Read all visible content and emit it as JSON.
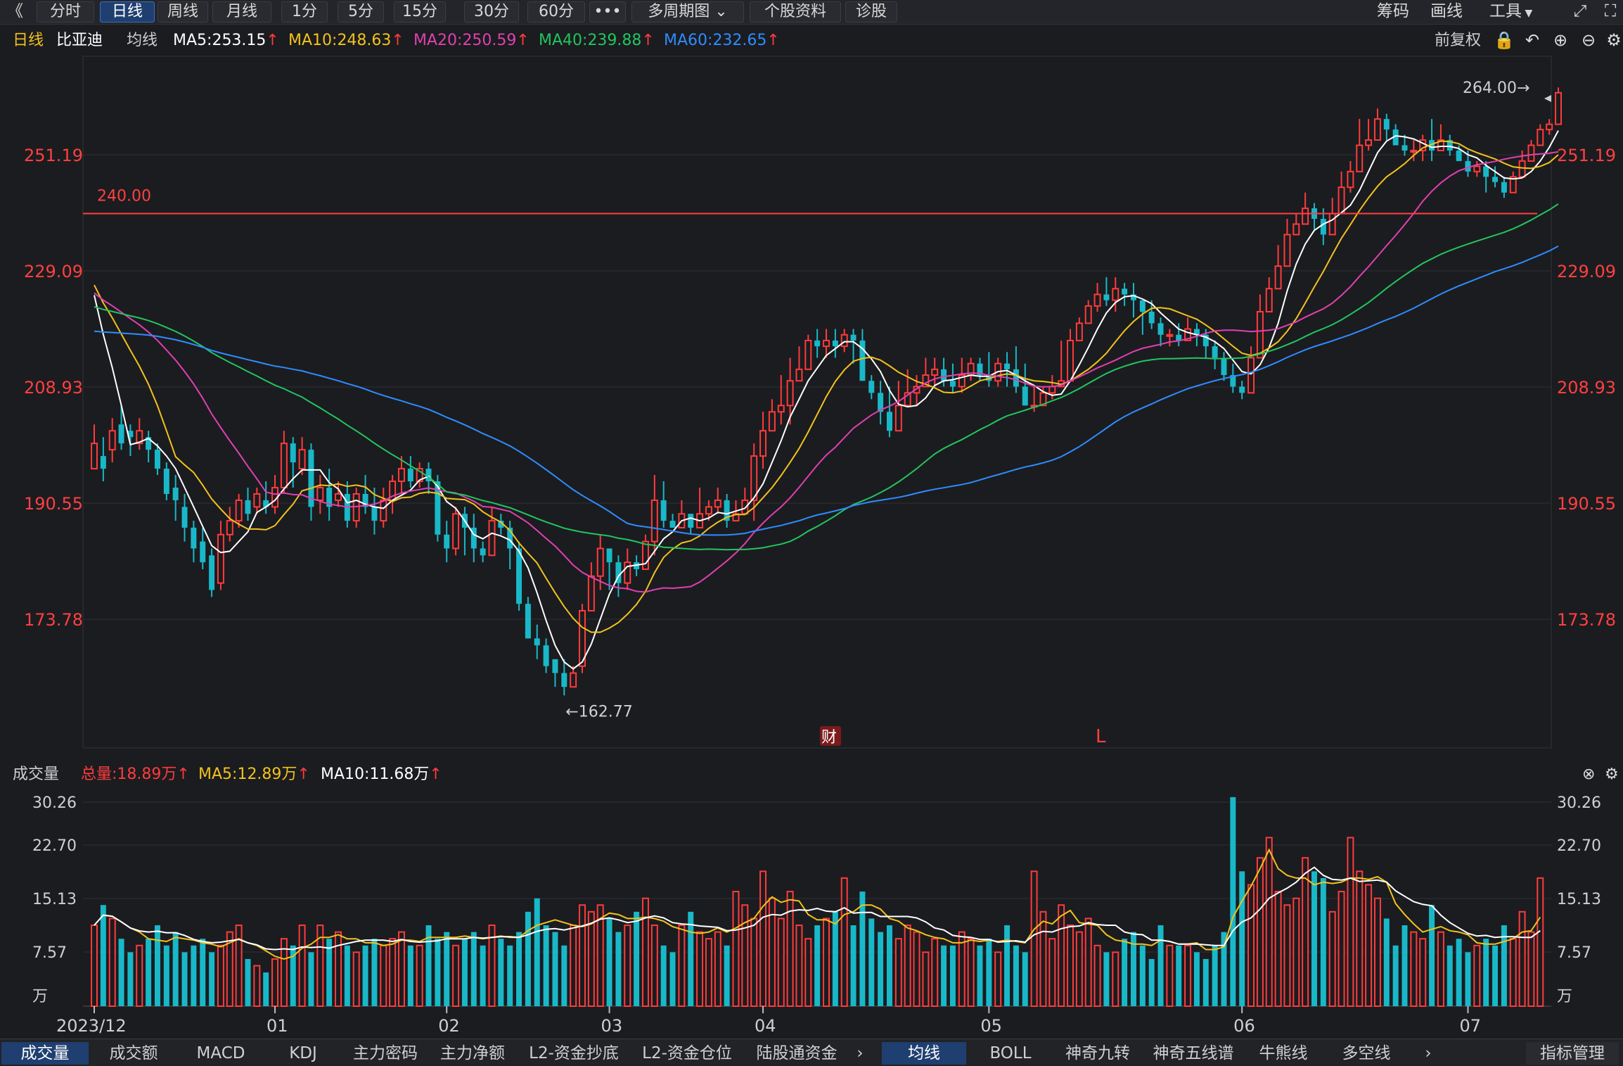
{
  "toolbar": {
    "back": "《",
    "tabs": [
      "分时",
      "日线",
      "周线",
      "月线",
      "1分",
      "5分",
      "15分",
      "30分",
      "60分",
      "•••",
      "多周期图",
      "个股资料",
      "诊股"
    ],
    "active_tab": "日线",
    "right": [
      "筹码",
      "画线",
      "工具"
    ]
  },
  "ma_header": {
    "period": "日线",
    "stock": "比亚迪",
    "label": "均线",
    "items": [
      {
        "text": "MA5:253.15",
        "color": "#ffffff"
      },
      {
        "text": "MA10:248.63",
        "color": "#f2c21b"
      },
      {
        "text": "MA20:250.59",
        "color": "#e040b0"
      },
      {
        "text": "MA40:239.88",
        "color": "#22c55e"
      },
      {
        "text": "MA60:232.65",
        "color": "#2f8cff"
      }
    ],
    "adjust": "前复权"
  },
  "price_panel": {
    "y_ticks": [
      "251.19",
      "229.09",
      "208.93",
      "190.55",
      "173.78"
    ],
    "hline_label": "240.00",
    "high_label": "264.00→",
    "low_label": "←162.77",
    "marker_cai": "财",
    "marker_l": "L"
  },
  "volume_header": {
    "title": "成交量",
    "total": "总量:18.89万",
    "ma5": "MA5:12.89万",
    "ma10": "MA10:11.68万"
  },
  "volume_panel": {
    "y_ticks": [
      "30.26",
      "22.70",
      "15.13",
      "7.57",
      "万"
    ]
  },
  "x_labels": [
    "2023/12",
    "01",
    "02",
    "03",
    "04",
    "05",
    "06",
    "07"
  ],
  "bottom_tabs_left": [
    "成交量",
    "成交额",
    "MACD",
    "KDJ",
    "主力密码",
    "主力净额",
    "L2-资金抄底",
    "L2-资金仓位",
    "陆股通资金"
  ],
  "bottom_tabs_right": [
    "均线",
    "BOLL",
    "神奇九转",
    "神奇五线谱",
    "牛熊线",
    "多空线"
  ],
  "bottom_right_button": "指标管理",
  "colors": {
    "up": "#ff3b3b",
    "down": "#19b8c8",
    "bg": "#1b1c20",
    "grid": "#2e3036"
  },
  "chart_data": {
    "type": "candlestick",
    "ylim": [
      162,
      264
    ],
    "hline": 240.0,
    "high": 264.0,
    "low": 162.77,
    "x": [
      "2023-12",
      "01",
      "02",
      "03",
      "04",
      "05",
      "06",
      "07"
    ],
    "ohlc": [
      [
        196,
        200,
        198,
        203
      ],
      [
        198,
        196,
        194,
        201
      ],
      [
        199,
        202,
        197,
        204
      ],
      [
        203,
        200,
        199,
        206
      ],
      [
        202,
        201,
        198,
        203
      ],
      [
        200,
        202,
        199,
        204
      ],
      [
        201,
        199,
        197,
        202
      ],
      [
        199,
        196,
        195,
        200
      ],
      [
        196,
        192,
        191,
        197
      ],
      [
        193,
        191,
        188,
        195
      ],
      [
        190,
        187,
        185,
        192
      ],
      [
        187,
        184,
        182,
        188
      ],
      [
        185,
        182,
        181,
        187
      ],
      [
        183,
        178,
        177,
        184
      ],
      [
        179,
        186,
        178,
        188
      ],
      [
        186,
        188,
        185,
        190
      ],
      [
        188,
        191,
        187,
        192
      ],
      [
        191,
        189,
        188,
        193
      ],
      [
        190,
        192,
        189,
        193
      ],
      [
        191,
        190,
        189,
        194
      ],
      [
        190,
        193,
        189,
        195
      ],
      [
        193,
        200,
        192,
        202
      ],
      [
        200,
        197,
        193,
        201
      ],
      [
        196,
        199,
        195,
        201
      ],
      [
        199,
        190,
        188,
        200
      ],
      [
        191,
        193,
        189,
        195
      ],
      [
        193,
        190,
        188,
        196
      ],
      [
        191,
        192,
        190,
        194
      ],
      [
        192,
        188,
        187,
        194
      ],
      [
        188,
        192,
        187,
        193
      ],
      [
        192,
        190,
        189,
        195
      ],
      [
        190,
        188,
        186,
        193
      ],
      [
        188,
        191,
        187,
        193
      ],
      [
        191,
        194,
        189,
        195
      ],
      [
        194,
        196,
        192,
        198
      ],
      [
        196,
        194,
        193,
        198
      ],
      [
        194,
        196,
        193,
        197
      ],
      [
        196,
        194,
        192,
        197
      ],
      [
        194,
        186,
        185,
        195
      ],
      [
        186,
        184,
        182,
        188
      ],
      [
        184,
        189,
        183,
        190
      ],
      [
        189,
        187,
        183,
        190
      ],
      [
        187,
        184,
        182,
        189
      ],
      [
        184,
        183,
        182,
        185
      ],
      [
        183,
        188,
        183,
        190
      ],
      [
        188,
        187,
        186,
        189
      ],
      [
        187,
        184,
        181,
        188
      ],
      [
        184,
        176,
        175,
        185
      ],
      [
        176,
        171,
        171,
        177
      ],
      [
        171,
        170,
        168,
        173
      ],
      [
        170,
        167,
        166,
        171
      ],
      [
        168,
        166,
        164,
        168
      ],
      [
        166,
        164,
        162.77,
        168
      ],
      [
        164,
        166,
        165,
        167
      ],
      [
        167,
        175,
        166,
        176
      ],
      [
        175,
        180,
        176,
        182
      ],
      [
        180,
        184,
        178,
        186
      ],
      [
        184,
        182,
        178,
        183
      ],
      [
        182,
        179,
        177,
        183
      ],
      [
        179,
        182,
        178,
        184
      ],
      [
        182,
        181,
        180,
        183
      ],
      [
        181,
        185,
        182,
        186
      ],
      [
        185,
        191,
        183,
        195
      ],
      [
        191,
        188,
        187,
        194
      ],
      [
        188,
        187,
        187,
        189
      ],
      [
        187,
        189,
        187,
        191
      ],
      [
        189,
        187,
        186,
        189
      ],
      [
        187,
        189,
        188,
        193
      ],
      [
        189,
        190,
        188,
        191
      ],
      [
        190,
        191,
        189,
        193
      ],
      [
        191,
        188,
        187,
        192
      ],
      [
        188,
        189,
        188,
        191
      ],
      [
        189,
        191,
        189,
        193
      ],
      [
        191,
        198,
        188,
        200
      ],
      [
        198,
        202,
        196,
        205
      ],
      [
        202,
        205,
        202,
        207
      ],
      [
        205,
        206,
        203,
        211
      ],
      [
        206,
        210,
        203,
        214
      ],
      [
        210,
        212,
        210,
        216
      ],
      [
        212,
        217,
        213,
        218
      ],
      [
        217,
        216,
        214,
        219
      ],
      [
        216,
        217,
        214,
        219
      ],
      [
        217,
        216,
        214,
        219
      ],
      [
        216,
        218,
        215,
        219
      ],
      [
        218,
        217,
        213,
        219
      ],
      [
        217,
        210,
        210,
        219
      ],
      [
        210,
        208,
        207,
        211
      ],
      [
        208,
        205,
        203,
        210
      ],
      [
        205,
        202,
        201,
        209
      ],
      [
        202,
        206,
        205,
        210
      ],
      [
        206,
        208,
        206,
        212
      ],
      [
        208,
        209,
        206,
        211
      ],
      [
        209,
        211,
        209,
        214
      ],
      [
        211,
        212,
        209,
        214
      ],
      [
        212,
        210,
        209,
        214
      ],
      [
        210,
        209,
        208,
        213
      ],
      [
        209,
        211,
        208,
        214
      ],
      [
        211,
        213,
        210,
        214
      ],
      [
        213,
        211,
        210,
        214
      ],
      [
        211,
        210,
        209,
        215
      ],
      [
        210,
        213,
        209,
        214
      ],
      [
        213,
        212,
        209,
        215
      ],
      [
        212,
        209,
        208,
        216
      ],
      [
        209,
        206,
        206,
        213
      ],
      [
        206,
        206,
        205,
        209
      ],
      [
        206,
        208,
        206,
        209
      ],
      [
        208,
        209,
        207,
        211
      ],
      [
        209,
        210,
        209,
        217
      ],
      [
        210,
        217,
        214,
        219
      ],
      [
        217,
        220,
        218,
        221
      ],
      [
        220,
        223,
        221,
        224
      ],
      [
        223,
        225,
        222,
        227
      ],
      [
        225,
        224,
        223,
        228
      ],
      [
        224,
        226,
        222,
        228
      ],
      [
        226,
        225,
        223,
        227
      ],
      [
        225,
        224,
        221,
        227
      ],
      [
        224,
        222,
        218,
        224
      ],
      [
        222,
        220,
        219,
        224
      ],
      [
        220,
        218,
        216,
        221
      ],
      [
        218,
        218,
        216,
        219
      ],
      [
        218,
        217,
        216,
        220
      ],
      [
        217,
        219,
        218,
        221
      ],
      [
        219,
        218,
        216,
        220
      ],
      [
        218,
        216,
        214,
        219
      ],
      [
        216,
        214,
        212,
        217
      ],
      [
        214,
        211,
        210,
        215
      ],
      [
        211,
        209,
        208,
        213
      ],
      [
        209,
        208,
        207,
        210
      ],
      [
        208,
        214,
        212,
        216
      ],
      [
        214,
        222,
        219,
        225
      ],
      [
        222,
        226,
        224,
        228
      ],
      [
        226,
        230,
        227,
        234
      ],
      [
        230,
        236,
        233,
        239
      ],
      [
        236,
        238,
        237,
        240
      ],
      [
        238,
        241,
        239,
        244
      ],
      [
        241,
        239,
        237,
        242
      ],
      [
        239,
        236,
        234,
        241
      ],
      [
        236,
        240,
        237,
        243
      ],
      [
        240,
        245,
        242,
        248
      ],
      [
        245,
        248,
        244,
        250
      ],
      [
        248,
        253,
        249,
        258
      ],
      [
        253,
        254,
        252,
        258
      ],
      [
        254,
        258,
        255,
        260
      ],
      [
        258,
        256,
        254,
        259
      ],
      [
        256,
        253,
        253,
        257
      ],
      [
        253,
        252,
        251,
        255
      ],
      [
        252,
        252,
        250,
        254
      ],
      [
        252,
        254,
        250,
        255
      ],
      [
        254,
        252,
        250,
        258
      ],
      [
        252,
        254,
        252,
        257
      ],
      [
        254,
        252,
        251,
        255
      ],
      [
        252,
        250,
        250,
        253
      ],
      [
        250,
        248,
        247,
        252
      ],
      [
        248,
        249,
        247,
        250
      ],
      [
        249,
        247,
        244,
        250
      ],
      [
        247,
        246,
        245,
        249
      ],
      [
        246,
        244,
        243,
        247
      ],
      [
        244,
        247,
        246,
        248
      ],
      [
        247,
        250,
        248,
        252
      ],
      [
        250,
        253,
        251,
        254
      ],
      [
        253,
        256,
        254,
        257
      ],
      [
        256,
        257,
        255,
        258
      ],
      [
        257,
        263,
        259,
        264
      ]
    ],
    "ma": {
      "MA5": {
        "color": "#ffffff"
      },
      "MA10": {
        "color": "#f2c21b"
      },
      "MA20": {
        "color": "#e040b0"
      },
      "MA40": {
        "color": "#22c55e"
      },
      "MA60": {
        "color": "#2f8cff"
      }
    },
    "volume_unit": "万",
    "volume_ylim": [
      0,
      30.26
    ],
    "volume": [
      12,
      15,
      13,
      10,
      8,
      9,
      10,
      12,
      9,
      11,
      8,
      9,
      10,
      8,
      9,
      11,
      12,
      7,
      6,
      5,
      7,
      10,
      9,
      12,
      8,
      12,
      10,
      11,
      9,
      8,
      9,
      10,
      9,
      10,
      11,
      9,
      9,
      12,
      10,
      11,
      9,
      10,
      11,
      9,
      12,
      10,
      9,
      11,
      14,
      16,
      12,
      11,
      9,
      12,
      15,
      14,
      15,
      13,
      11,
      12,
      14,
      16,
      12,
      9,
      8,
      12,
      14,
      11,
      10,
      11,
      9,
      17,
      15,
      13,
      20,
      16,
      13,
      17,
      12,
      10,
      12,
      13,
      14,
      19,
      12,
      17,
      13,
      11,
      12,
      10,
      12,
      11,
      8,
      10,
      9,
      9,
      11,
      10,
      9,
      10,
      8,
      12,
      9,
      8,
      20,
      14,
      10,
      15,
      12,
      11,
      13,
      9,
      8,
      8,
      10,
      11,
      9,
      7,
      12,
      9,
      9,
      9,
      8,
      7,
      9,
      11,
      31,
      20,
      18,
      22,
      25,
      17,
      15,
      16,
      22,
      20,
      19,
      14,
      17,
      25,
      20,
      18,
      16,
      13,
      9,
      12,
      11,
      10,
      15,
      11,
      9,
      10,
      8,
      9,
      10,
      9,
      12,
      10,
      14,
      11,
      19
    ]
  }
}
